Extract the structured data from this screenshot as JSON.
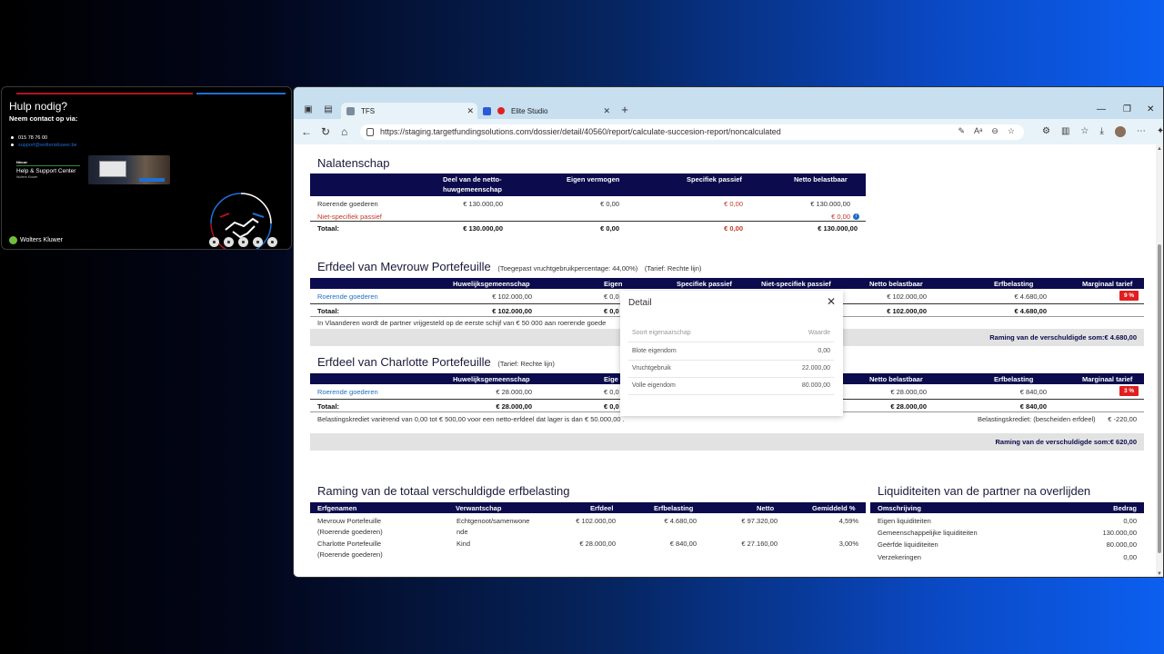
{
  "help_card": {
    "title": "Hulp nodig?",
    "subtitle": "Neem contact op via:",
    "phone": "015 78 76 00",
    "email": "support@wolterskluwer.be",
    "new_tag": "Nieuw",
    "support_center": "Help & Support Center",
    "support_brand": "Wolters Kluwer",
    "company": "Wolters Kluwer",
    "colors": {
      "red": "#b0141e",
      "blue": "#1d6fd6",
      "green": "#6fbf3a"
    }
  },
  "browser": {
    "tabs": [
      {
        "label": "TFS",
        "active": true
      },
      {
        "label": "Elite Studio",
        "active": false
      }
    ],
    "url": "https://staging.targetfundingsolutions.com/dossier/detail/40560/report/calculate-succesion-report/noncalculated"
  },
  "nalatenschap": {
    "title": "Nalatenschap",
    "headers": [
      "Deel van de netto-huwgemeenschap",
      "Eigen vermogen",
      "Specifiek passief",
      "Netto belastbaar"
    ],
    "header_line1": "Deel van de netto-",
    "header_line2": "huwgemeenschap",
    "rows": [
      {
        "label": "Roerende goederen",
        "deel": "€ 130.000,00",
        "eigen": "€ 0,00",
        "specifiek": "€ 0,00",
        "netto": "€ 130.000,00"
      },
      {
        "label": "Niet-specifiek passief",
        "deel": "",
        "eigen": "",
        "specifiek": "",
        "netto": "€ 0,00"
      }
    ],
    "total": {
      "label": "Totaal:",
      "deel": "€ 130.000,00",
      "eigen": "€ 0,00",
      "specifiek": "€ 0,00",
      "netto": "€ 130.000,00"
    }
  },
  "erfdeel_mevrouw": {
    "title": "Erfdeel van Mevrouw Portefeuille",
    "note1": "(Toegepast vruchtgebruikpercentage: 44,00%)",
    "note2": "(Tarief: Rechte lijn)",
    "headers": [
      "Huwelijksgemeenschap",
      "Eigen",
      "Specifiek passief",
      "Niet-specifiek passief",
      "Netto belastbaar",
      "Erfbelasting",
      "Marginaal tarief"
    ],
    "row": {
      "label": "Roerende goederen",
      "huw": "€ 102.000,00",
      "eigen": "€ 0,0",
      "netto": "€ 102.000,00",
      "erf": "€ 4.680,00",
      "tarief": "9 %"
    },
    "total": {
      "label": "Totaal:",
      "huw": "€ 102.000,00",
      "eigen": "€ 0,0",
      "netto": "€ 102.000,00",
      "erf": "€ 4.680,00"
    },
    "footnote": "In Vlaanderen wordt de partner vrijgesteld op de eerste schijf van € 50 000 aan roerende goede",
    "raming": "Raming van de verschuldigde som:€ 4.680,00"
  },
  "erfdeel_charlotte": {
    "title": "Erfdeel van Charlotte Portefeuille",
    "note": "(Tarief: Rechte lijn)",
    "headers": [
      "Huwelijksgemeenschap",
      "Eige",
      "Netto belastbaar",
      "Erfbelasting",
      "Marginaal tarief"
    ],
    "row": {
      "label": "Roerende goederen",
      "huw": "€ 28.000,00",
      "eigen": "€ 0,0",
      "netto": "€ 28.000,00",
      "erf": "€ 840,00",
      "tarief": "3 %"
    },
    "total": {
      "label": "Totaal:",
      "huw": "€ 28.000,00",
      "eigen": "€ 0,0",
      "netto": "€ 28.000,00",
      "erf": "€ 840,00"
    },
    "footnote": "Belastingskrediet variërend van 0,00 tot € 500,00 voor een netto-erfdeel dat lager is dan € 50.000,00 .",
    "krediet_label": "Belastingskrediet: (bescheiden erfdeel)",
    "krediet_value": "€ -220,00",
    "raming": "Raming van de verschuldigde som:€ 620,00"
  },
  "detail_popup": {
    "title": "Detail",
    "col1": "Soort eigenaarschap",
    "col2": "Waarde",
    "rows": [
      {
        "label": "Blote eigendom",
        "value": "0,00"
      },
      {
        "label": "Vruchtgebruik",
        "value": "22.000,00"
      },
      {
        "label": "Volle eigendom",
        "value": "80.000,00"
      }
    ]
  },
  "raming_totaal": {
    "title": "Raming van de totaal verschuldigde erfbelasting",
    "headers": [
      "Erfgenamen",
      "Verwantschap",
      "Erfdeel",
      "Erfbelasting",
      "Netto",
      "Gemiddeld %"
    ],
    "rows": [
      {
        "name": "Mevrouw Portefeuille",
        "sub": "(Roerende goederen)",
        "verwantschap": "Echtgenoot/samenwone",
        "verwantschap2": "nde",
        "erfdeel": "€ 102.000,00",
        "erfbelasting": "€ 4.680,00",
        "netto": "€ 97.320,00",
        "gem": "4,59%"
      },
      {
        "name": "Charlotte Portefeuille",
        "sub": "(Roerende goederen)",
        "verwantschap": "Kind",
        "verwantschap2": "",
        "erfdeel": "€ 28.000,00",
        "erfbelasting": "€ 840,00",
        "netto": "€ 27.160,00",
        "gem": "3,00%"
      }
    ]
  },
  "liquiditeiten": {
    "title": "Liquiditeiten van de partner na overlijden",
    "headers": [
      "Omschrijving",
      "Bedrag"
    ],
    "rows": [
      {
        "label": "Eigen liquiditeiten",
        "value": "0,00"
      },
      {
        "label": "Gemeenschappelijke liquiditeiten",
        "value": "130.000,00"
      },
      {
        "label": "Geërfde liquiditeiten",
        "value": "80.000,00"
      },
      {
        "label": "Verzekeringen",
        "value": "0,00"
      }
    ]
  }
}
